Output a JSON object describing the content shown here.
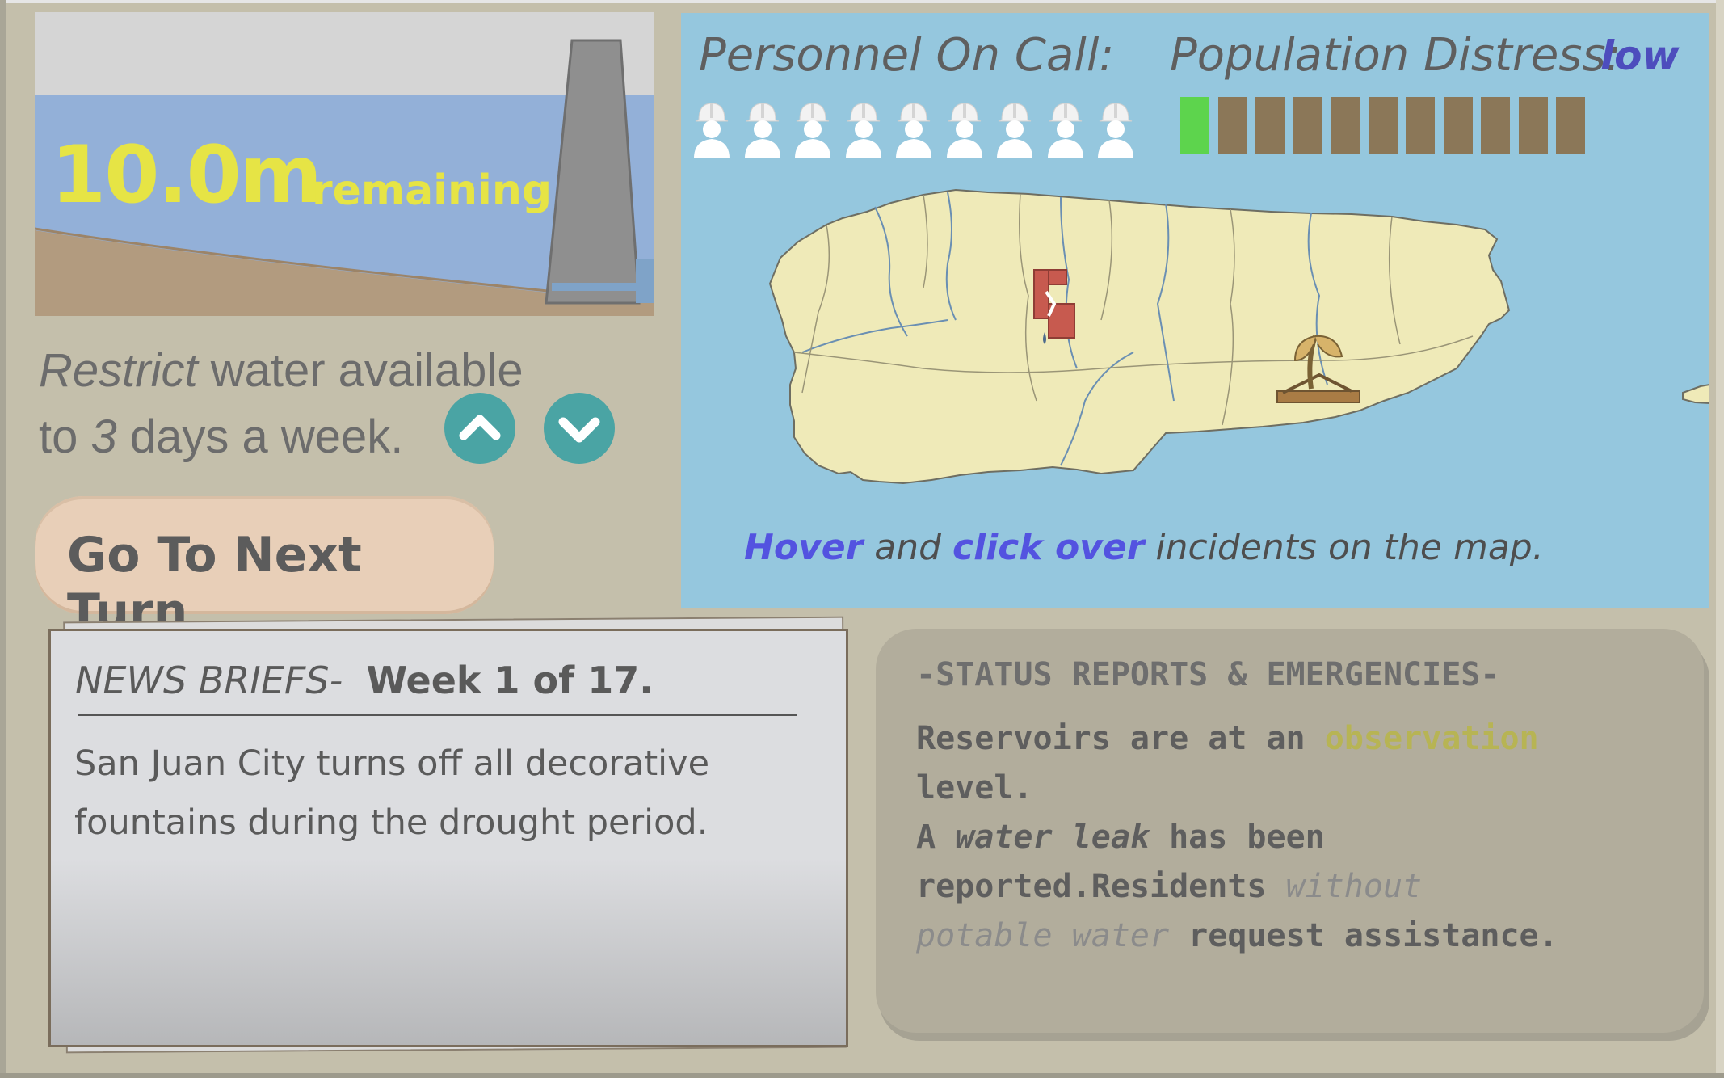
{
  "reservoir": {
    "value": "10.0m",
    "label": "remaining",
    "water_level_fraction": 0.72
  },
  "restriction": {
    "verb": "Restrict",
    "line1_rest": " water available",
    "line2_prefix": "to ",
    "days": "3",
    "line2_suffix": " days a week.",
    "up_icon": "chevron-up-icon",
    "down_icon": "chevron-down-icon"
  },
  "next_turn": {
    "label": "Go To Next Turn"
  },
  "map": {
    "personnel_label": "Personnel On Call:",
    "personnel_count": 9,
    "distress_label": "Population Distress:",
    "distress_value": "low",
    "distress_level": 1,
    "distress_max": 11,
    "hint_hover": "Hover",
    "hint_and": " and ",
    "hint_click": "click over",
    "hint_rest": " incidents on the map.",
    "incidents": [
      {
        "icon": "broken-pipe-icon",
        "type": "water leak"
      },
      {
        "icon": "dry-plant-icon",
        "type": "drought"
      }
    ],
    "colors": {
      "sea": "#95c7de",
      "land": "#efeab8",
      "distress_on": "#5dd44d",
      "distress_off": "#8b7758"
    }
  },
  "news": {
    "heading": "NEWS BRIEFS-",
    "week": "Week 1 of 17.",
    "body": "San Juan City turns off all decorative fountains during the drought period."
  },
  "status": {
    "title": "-STATUS REPORTS & EMERGENCIES-",
    "line1_a": "Reservoirs are at an ",
    "line1_level": "observation",
    "line1_b": "level.",
    "line2_a": "A ",
    "line2_leak": "water leak",
    "line2_b": " has been",
    "line3_a": "reported.Residents ",
    "line3_without": "without",
    "line4_potable": "potable water",
    "line4_b": " request assistance."
  }
}
